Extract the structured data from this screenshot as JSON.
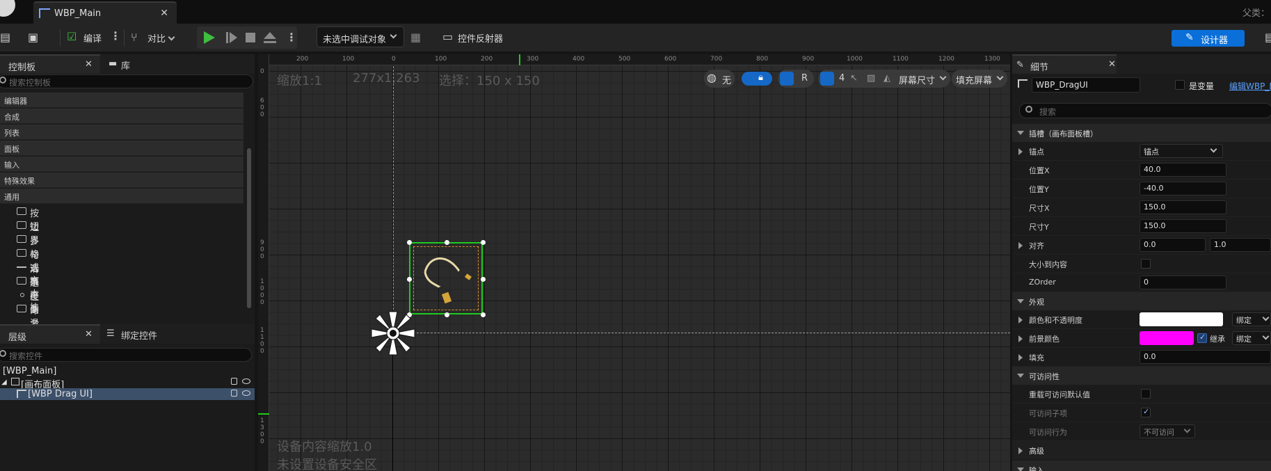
{
  "app": {
    "tab_title": "WBP_Main",
    "parent_label": "父类：",
    "toolbar": {
      "compile": "编译",
      "diff": "对比",
      "debug_target": "未选中调试对象",
      "widget_reflector": "控件反射器",
      "designer": "设计器"
    }
  },
  "palette": {
    "tab_control": "控制板",
    "tab_library": "库",
    "search_placeholder": "搜索控制板",
    "categories": [
      "编辑器",
      "合成",
      "列表",
      "面板",
      "输入",
      "特殊效果",
      "通用"
    ],
    "items": [
      "按钮",
      "边界",
      "多格式文本块",
      "勾选框",
      "滑条",
      "进度条",
      "径向滑条",
      "命名的插槽",
      "图像"
    ]
  },
  "hierarchy": {
    "tab_hierarchy": "层级",
    "tab_bind": "绑定控件",
    "search_placeholder": "搜索控件",
    "root": "[WBP_Main]",
    "canvas": "[画布面板]",
    "child": "[WBP Drag UI]"
  },
  "viewport": {
    "zoom": "缩放1:1",
    "resolution": "277x1,263",
    "selection": "选择：150 x 150",
    "none_label": "无",
    "r_label": "R",
    "grid_count": "4",
    "screen_size": "屏幕尺寸",
    "fill_screen": "填充屏幕",
    "device_scale": "设备内容缩放1.0",
    "safe_zone": "未设置设备安全区",
    "ruler_top": [
      "200",
      "100",
      "0",
      "100",
      "200",
      "300",
      "400",
      "500",
      "600",
      "700",
      "800",
      "900",
      "1000",
      "1100",
      "1200",
      "1300"
    ],
    "ruler_left": [
      "0",
      "600",
      "900",
      "1000",
      "1100",
      "1300"
    ]
  },
  "details": {
    "tab_title": "细节",
    "name_value": "WBP_DragUI",
    "is_variable": "是变量",
    "edit_link": "编辑WBP_D",
    "search_placeholder": "搜索",
    "section_slot": "插槽（画布面板槽）",
    "anchor_label": "锚点",
    "anchor_value": "锚点",
    "pos_x_label": "位置X",
    "pos_x": "40.0",
    "pos_y_label": "位置Y",
    "pos_y": "-40.0",
    "size_x_label": "尺寸X",
    "size_x": "150.0",
    "size_y_label": "尺寸Y",
    "size_y": "150.0",
    "align_label": "对齐",
    "align_x": "0.0",
    "align_y": "1.0",
    "size_to_content": "大小到内容",
    "zorder_label": "ZOrder",
    "zorder": "0",
    "section_appearance": "外观",
    "color_opacity": "颜色和不透明度",
    "bind_label": "绑定",
    "fg_color": "前景颜色",
    "inherit_label": "继承",
    "padding_label": "填充",
    "padding_value": "0.0",
    "section_accessibility": "可访问性",
    "override_access": "重载可访问默认值",
    "access_children": "可访问子项",
    "access_behavior": "可访问行为",
    "access_behavior_value": "不可访问",
    "section_advanced": "高级",
    "section_input": "输入"
  },
  "colors": {
    "accent": "#0a6fd8",
    "selection_green": "#1ecc1e",
    "fg_magenta": "#ff00ff"
  }
}
